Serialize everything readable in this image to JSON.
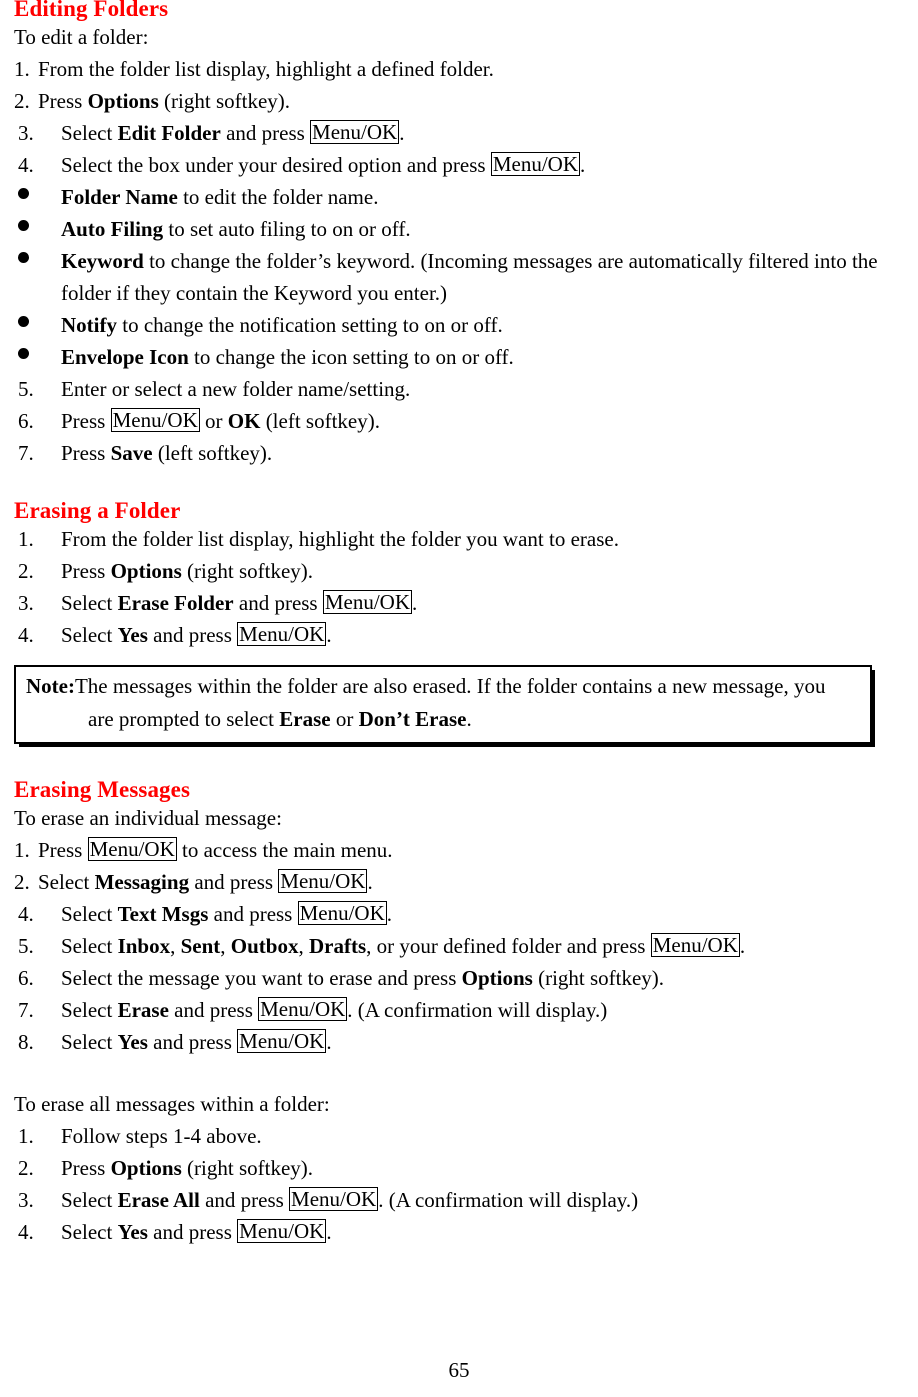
{
  "document": {
    "page_number": "65",
    "heading_color": "#ff0000",
    "text_color": "#000000"
  },
  "sections": [
    {
      "heading": "Editing Folders",
      "intro": "To edit a folder:",
      "steps": [
        {
          "marker": "1.",
          "parts": [
            {
              "t": "From the folder list display, highlight a defined folder.",
              "s": "n"
            }
          ]
        },
        {
          "marker": "2.",
          "parts": [
            {
              "t": "Press ",
              "s": "n"
            },
            {
              "t": "Options",
              "s": "b"
            },
            {
              "t": " (right softkey).",
              "s": "n"
            }
          ]
        },
        {
          "marker": "3.",
          "parts": [
            {
              "t": "Select ",
              "s": "n"
            },
            {
              "t": "Edit Folder",
              "s": "b"
            },
            {
              "t": " and press ",
              "s": "n"
            },
            {
              "t": "Menu/OK",
              "s": "k"
            },
            {
              "t": ".",
              "s": "n"
            }
          ]
        },
        {
          "marker": "4.",
          "parts": [
            {
              "t": "Select the box under your desired option and press ",
              "s": "n"
            },
            {
              "t": "Menu/OK",
              "s": "k"
            },
            {
              "t": ".",
              "s": "n"
            }
          ]
        }
      ],
      "bullets": [
        {
          "parts": [
            {
              "t": "Folder Name",
              "s": "b"
            },
            {
              "t": " to edit the folder name.",
              "s": "n"
            }
          ]
        },
        {
          "parts": [
            {
              "t": "Auto Filing",
              "s": "b"
            },
            {
              "t": " to set auto filing to on or off.",
              "s": "n"
            }
          ]
        },
        {
          "parts": [
            {
              "t": "Keyword",
              "s": "b"
            },
            {
              "t": " to change the folder’s keyword. (Incoming messages are automatically filtered into the folder if they contain the Keyword you enter.)",
              "s": "n"
            }
          ]
        },
        {
          "parts": [
            {
              "t": "Notify",
              "s": "b"
            },
            {
              "t": " to change the notification setting to on or off.",
              "s": "n"
            }
          ]
        },
        {
          "parts": [
            {
              "t": "Envelope Icon",
              "s": "b"
            },
            {
              "t": " to change the icon setting to on or off.",
              "s": "n"
            }
          ]
        }
      ],
      "steps_after": [
        {
          "marker": "5.",
          "parts": [
            {
              "t": "Enter or select a new folder name/setting.",
              "s": "n"
            }
          ]
        },
        {
          "marker": "6.",
          "parts": [
            {
              "t": "Press ",
              "s": "n"
            },
            {
              "t": "Menu/OK",
              "s": "k"
            },
            {
              "t": " or ",
              "s": "n"
            },
            {
              "t": "OK",
              "s": "b"
            },
            {
              "t": " (left softkey).",
              "s": "n"
            }
          ]
        },
        {
          "marker": "7.",
          "parts": [
            {
              "t": "Press ",
              "s": "n"
            },
            {
              "t": "Save",
              "s": "b"
            },
            {
              "t": " (left softkey).",
              "s": "n"
            }
          ]
        }
      ]
    },
    {
      "heading": "Erasing a Folder",
      "steps": [
        {
          "marker": "1.",
          "parts": [
            {
              "t": "From the folder list display, highlight the folder you want to erase.",
              "s": "n"
            }
          ]
        },
        {
          "marker": "2.",
          "parts": [
            {
              "t": "Press ",
              "s": "n"
            },
            {
              "t": "Options",
              "s": "b"
            },
            {
              "t": " (right softkey).",
              "s": "n"
            }
          ]
        },
        {
          "marker": "3.",
          "parts": [
            {
              "t": "Select ",
              "s": "n"
            },
            {
              "t": "Erase Folder",
              "s": "b"
            },
            {
              "t": " and press ",
              "s": "n"
            },
            {
              "t": "Menu/OK",
              "s": "k"
            },
            {
              "t": ".",
              "s": "n"
            }
          ]
        },
        {
          "marker": "4.",
          "parts": [
            {
              "t": "Select ",
              "s": "n"
            },
            {
              "t": "Yes",
              "s": "b"
            },
            {
              "t": " and press ",
              "s": "n"
            },
            {
              "t": "Menu/OK",
              "s": "k"
            },
            {
              "t": ".",
              "s": "n"
            }
          ]
        }
      ],
      "note": {
        "label": "Note:",
        "line1_parts": [
          {
            "t": " The messages within the folder are also erased. If the folder contains a new message, you",
            "s": "n"
          }
        ],
        "line2_parts": [
          {
            "t": "are prompted to select ",
            "s": "n"
          },
          {
            "t": "Erase",
            "s": "b"
          },
          {
            "t": " or ",
            "s": "n"
          },
          {
            "t": "Don’t Erase",
            "s": "b"
          },
          {
            "t": ".",
            "s": "n"
          }
        ]
      }
    },
    {
      "heading": "Erasing Messages",
      "intro": "To erase an individual message:",
      "steps": [
        {
          "marker": "1.",
          "parts": [
            {
              "t": "Press ",
              "s": "n"
            },
            {
              "t": "Menu/OK",
              "s": "k"
            },
            {
              "t": " to access the main menu.",
              "s": "n"
            }
          ]
        },
        {
          "marker": "2.",
          "parts": [
            {
              "t": "Select ",
              "s": "n"
            },
            {
              "t": "Messaging",
              "s": "b"
            },
            {
              "t": " and press ",
              "s": "n"
            },
            {
              "t": "Menu/OK",
              "s": "k"
            },
            {
              "t": ".",
              "s": "n"
            }
          ]
        },
        {
          "marker": "4.",
          "parts": [
            {
              "t": "Select ",
              "s": "n"
            },
            {
              "t": "Text Msgs",
              "s": "b"
            },
            {
              "t": " and press ",
              "s": "n"
            },
            {
              "t": "Menu/OK",
              "s": "k"
            },
            {
              "t": ".",
              "s": "n"
            }
          ]
        },
        {
          "marker": "5.",
          "parts": [
            {
              "t": "Select ",
              "s": "n"
            },
            {
              "t": "Inbox",
              "s": "b"
            },
            {
              "t": ", ",
              "s": "n"
            },
            {
              "t": "Sent",
              "s": "b"
            },
            {
              "t": ", ",
              "s": "n"
            },
            {
              "t": "Outbox",
              "s": "b"
            },
            {
              "t": ", ",
              "s": "n"
            },
            {
              "t": "Drafts",
              "s": "b"
            },
            {
              "t": ", or your defined folder and press ",
              "s": "n"
            },
            {
              "t": "Menu/OK",
              "s": "k"
            },
            {
              "t": ".",
              "s": "n"
            }
          ]
        },
        {
          "marker": "6.",
          "parts": [
            {
              "t": "Select the message you want to erase and press ",
              "s": "n"
            },
            {
              "t": "Options",
              "s": "b"
            },
            {
              "t": " (right softkey).",
              "s": "n"
            }
          ]
        },
        {
          "marker": "7.",
          "parts": [
            {
              "t": "Select ",
              "s": "n"
            },
            {
              "t": "Erase",
              "s": "b"
            },
            {
              "t": " and press ",
              "s": "n"
            },
            {
              "t": "Menu/OK",
              "s": "k"
            },
            {
              "t": ". (A confirmation will display.)",
              "s": "n"
            }
          ]
        },
        {
          "marker": "8.",
          "parts": [
            {
              "t": "Select ",
              "s": "n"
            },
            {
              "t": "Yes",
              "s": "b"
            },
            {
              "t": " and press ",
              "s": "n"
            },
            {
              "t": "Menu/OK",
              "s": "k"
            },
            {
              "t": ".",
              "s": "n"
            }
          ]
        }
      ],
      "intro2": "To erase all messages within a folder:",
      "steps2": [
        {
          "marker": "1.",
          "parts": [
            {
              "t": "Follow steps 1-4 above.",
              "s": "n"
            }
          ]
        },
        {
          "marker": "2.",
          "parts": [
            {
              "t": "Press ",
              "s": "n"
            },
            {
              "t": "Options",
              "s": "b"
            },
            {
              "t": " (right softkey).",
              "s": "n"
            }
          ]
        },
        {
          "marker": "3.",
          "parts": [
            {
              "t": "Select ",
              "s": "n"
            },
            {
              "t": "Erase All",
              "s": "b"
            },
            {
              "t": " and press ",
              "s": "n"
            },
            {
              "t": "Menu/OK",
              "s": "k"
            },
            {
              "t": ". (A confirmation will display.)",
              "s": "n"
            }
          ]
        },
        {
          "marker": "4.",
          "parts": [
            {
              "t": "Select ",
              "s": "n"
            },
            {
              "t": "Yes",
              "s": "b"
            },
            {
              "t": " and press ",
              "s": "n"
            },
            {
              "t": "Menu/OK",
              "s": "k"
            },
            {
              "t": ".",
              "s": "n"
            }
          ]
        }
      ]
    }
  ]
}
